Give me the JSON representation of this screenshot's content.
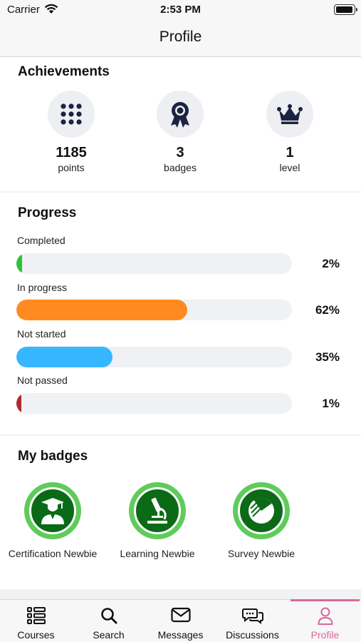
{
  "status_bar": {
    "carrier": "Carrier",
    "time": "2:53 PM"
  },
  "nav": {
    "title": "Profile"
  },
  "achievements": {
    "title": "Achievements",
    "items": [
      {
        "value": "1185",
        "label": "points",
        "icon": "grid-dots-icon"
      },
      {
        "value": "3",
        "label": "badges",
        "icon": "award-ribbon-icon"
      },
      {
        "value": "1",
        "label": "level",
        "icon": "crown-icon"
      }
    ]
  },
  "progress": {
    "title": "Progress",
    "items": [
      {
        "label": "Completed",
        "percent_text": "2%",
        "percent": 2,
        "color": "#2ec23a"
      },
      {
        "label": "In progress",
        "percent_text": "62%",
        "percent": 62,
        "color": "#ff8a1f"
      },
      {
        "label": "Not started",
        "percent_text": "35%",
        "percent": 35,
        "color": "#35b6ff"
      },
      {
        "label": "Not passed",
        "percent_text": "1%",
        "percent": 1,
        "color": "#b3282a"
      }
    ]
  },
  "badges": {
    "title": "My badges",
    "items": [
      {
        "label": "Certification Newbie",
        "icon": "graduate-icon"
      },
      {
        "label": "Learning Newbie",
        "icon": "microscope-icon"
      },
      {
        "label": "Survey Newbie",
        "icon": "survey-chart-icon"
      }
    ]
  },
  "tabs": [
    {
      "label": "Courses",
      "icon": "courses-list-icon",
      "active": false
    },
    {
      "label": "Search",
      "icon": "search-icon",
      "active": false
    },
    {
      "label": "Messages",
      "icon": "envelope-icon",
      "active": false
    },
    {
      "label": "Discussions",
      "icon": "chat-bubbles-icon",
      "active": false
    },
    {
      "label": "Profile",
      "icon": "user-icon",
      "active": true
    }
  ],
  "colors": {
    "accent": "#d9689a",
    "badge_green": "#0b6a16",
    "badge_ring": "#5fcb5b",
    "icon_navy": "#1c2340"
  }
}
